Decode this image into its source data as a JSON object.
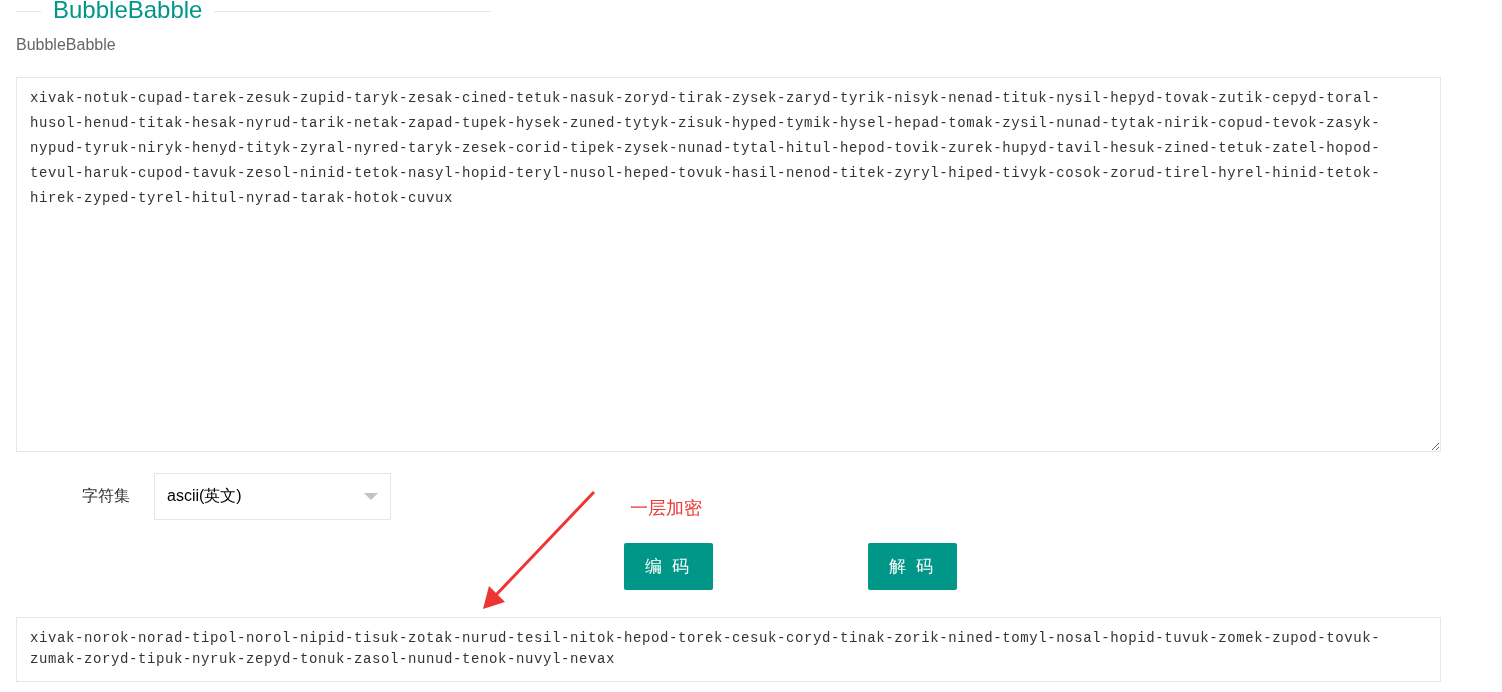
{
  "section": {
    "legend": "BubbleBabble",
    "label": "BubbleBabble"
  },
  "input": {
    "lines": [
      "xivak-notuk-cupad-tarek-zesuk-zupid-taryk-zesak-cined-tetuk-nasuk-zoryd-tirak-zysek-zaryd-tyrik-nisyk-nenad-tituk-nysil-hepyd-tovak-zutik-cepyd-toral-",
      "husol-henud-titak-hesak-nyrud-tarik-netak-zapad-tupek-hysek-zuned-tytyk-zisuk-hyped-tymik-hysel-hepad-tomak-zysil-nunad-tytak-nirik-copud-tevok-zasyk-",
      "nypud-tyruk-niryk-henyd-tityk-zyral-nyred-taryk-zesek-corid-tipek-zysek-nunad-tytal-hitul-hepod-tovik-zurek-hupyd-tavil-hesuk-zined-tetuk-zatel-hopod-",
      "tevul-haruk-cupod-tavuk-zesol-ninid-tetok-nasyl-hopid-teryl-nusol-heped-tovuk-hasil-nenod-titek-zyryl-hiped-tivyk-cosok-zorud-tirel-hyrel-hinid-tetok-",
      "hirek-zyped-tyrel-hitul-nyrad-tarak-hotok-cuvux"
    ]
  },
  "charset": {
    "label": "字符集",
    "value": "ascii(英文)"
  },
  "annotation": {
    "text": "一层加密"
  },
  "buttons": [
    {
      "label": "编 码"
    },
    {
      "label": "解 码"
    }
  ],
  "output": {
    "lines": [
      "xivak-norok-norad-tipol-norol-nipid-tisuk-zotak-nurud-tesil-nitok-hepod-torek-cesuk-coryd-tinak-zorik-nined-tomyl-nosal-hopid-tuvuk-zomek-zupod-tovuk-",
      "zumak-zoryd-tipuk-nyruk-zepyd-tonuk-zasol-nunud-tenok-nuvyl-nevax"
    ]
  }
}
